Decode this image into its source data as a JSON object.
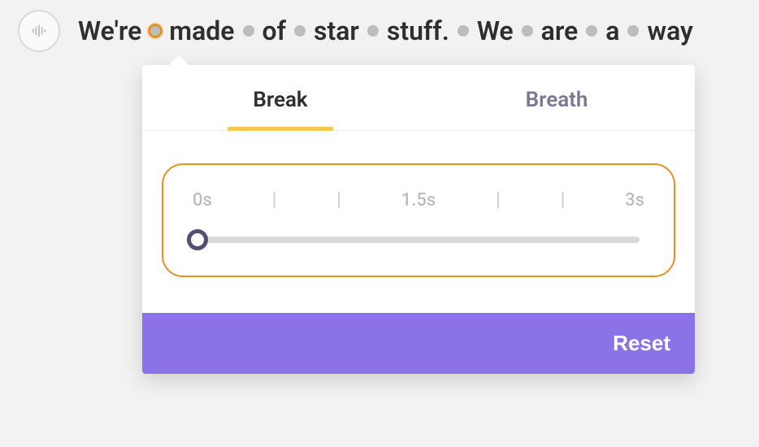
{
  "textRow": {
    "words": [
      "We're",
      "made",
      "of",
      "star",
      "stuff.",
      "We",
      "are",
      "a",
      "way"
    ],
    "activeDotAfterIndex": 0
  },
  "popover": {
    "tabs": [
      {
        "label": "Break",
        "active": true
      },
      {
        "label": "Breath",
        "active": false
      }
    ],
    "slider": {
      "ticks": [
        "0s",
        "|",
        "|",
        "1.5s",
        "|",
        "|",
        "3s"
      ],
      "valuePercent": 0
    },
    "resetLabel": "Reset"
  }
}
